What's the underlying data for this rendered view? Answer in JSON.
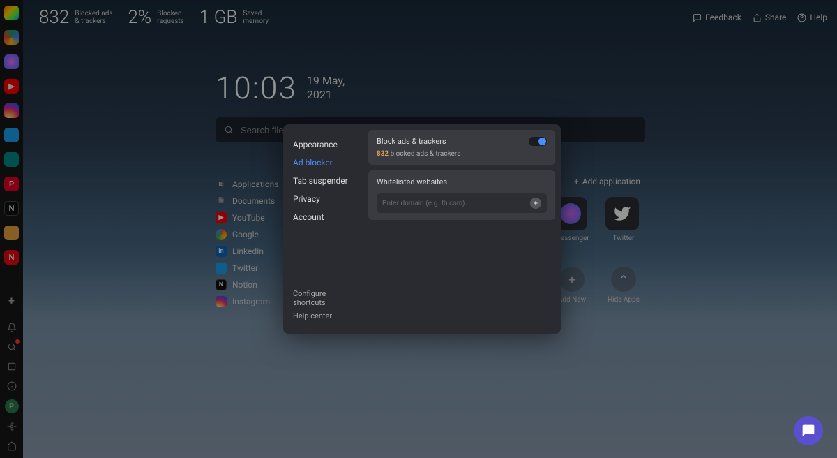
{
  "stats": {
    "blocked_ads_value": "832",
    "blocked_ads_label": "Blocked ads\n& trackers",
    "blocked_pct_value": "2%",
    "blocked_pct_label": "Blocked\nrequests",
    "saved_mem_value": "1 GB",
    "saved_mem_label": "Saved\nmemory"
  },
  "topright": {
    "feedback": "Feedback",
    "share": "Share",
    "help": "Help"
  },
  "clock": {
    "time": "10:03",
    "date_line1": "19 May,",
    "date_line2": "2021"
  },
  "search": {
    "placeholder": "Search files, applications..."
  },
  "left_items": [
    {
      "icon": "apps-icon",
      "label": "Applications"
    },
    {
      "icon": "documents-icon",
      "label": "Documents"
    },
    {
      "icon": "youtube-icon",
      "label": "YouTube"
    },
    {
      "icon": "google-icon",
      "label": "Google"
    },
    {
      "icon": "linkedin-icon",
      "label": "LinkedIn"
    },
    {
      "icon": "twitter-icon",
      "label": "Twitter"
    },
    {
      "icon": "notion-icon",
      "label": "Notion"
    },
    {
      "icon": "instagram-icon",
      "label": "Instagram"
    }
  ],
  "tiles": {
    "add_application": "Add application",
    "messenger": "Messenger",
    "twitter": "Twitter",
    "add_new": "Add New",
    "hide_apps": "Hide Apps"
  },
  "modal": {
    "menu": {
      "appearance": "Appearance",
      "adblocker": "Ad blocker",
      "tabsuspender": "Tab suspender",
      "privacy": "Privacy",
      "account": "Account"
    },
    "bottom": {
      "shortcuts": "Configure shortcuts",
      "helpcenter": "Help center"
    },
    "blocker": {
      "title": "Block ads & trackers",
      "count": "832",
      "count_label": "blocked ads & trackers"
    },
    "whitelist": {
      "title": "Whitelisted websites",
      "placeholder": "Enter domain (e.g. fb.com)"
    }
  },
  "sidebar_icons": [
    "app-multicolor",
    "gdrive",
    "messenger",
    "youtube",
    "instagram",
    "twitter",
    "teal-app",
    "pinterest",
    "notion",
    "slack",
    "netflix"
  ]
}
